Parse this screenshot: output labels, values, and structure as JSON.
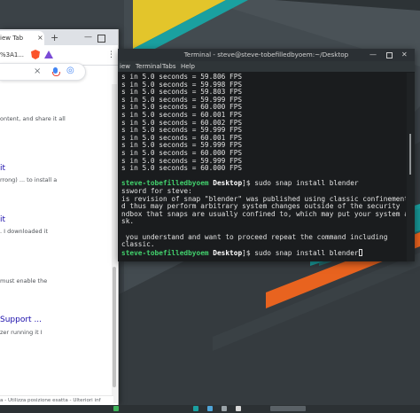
{
  "colors": {
    "accent_green": "#42d16d",
    "stripe_yellow": "#e3c52b",
    "stripe_teal": "#1aa0a0",
    "stripe_orange": "#e8631f",
    "terminal_bg": "#1a1c1e"
  },
  "browser": {
    "tab_title": "iew Tab",
    "tab_close": "×",
    "new_tab": "+",
    "minimize": "—",
    "url_fragment": "%3A1...",
    "menu_icon": "⋮",
    "search_clear": "×",
    "results": [
      {
        "snippet": "ontent, and share it all"
      },
      {
        "link": "it",
        "snippet": "rrong) ... to install a"
      },
      {
        "link": "it",
        "snippet": ". I downloaded it"
      },
      {
        "snippet": "must enable the"
      },
      {
        "link": "Support ...",
        "snippet": "zer running it I"
      }
    ],
    "status_text": "a - Utilizza posizione esatta - Ulteriori inf"
  },
  "terminal": {
    "title": "Terminal - steve@steve-tobefilledbyoem:~/Desktop",
    "menu": [
      "iew",
      "Terminal",
      "Tabs",
      "Help"
    ],
    "fps_lines": [
      "s in 5.0 seconds = 59.806 FPS",
      "s in 5.0 seconds = 59.998 FPS",
      "s in 5.0 seconds = 59.803 FPS",
      "s in 5.0 seconds = 59.999 FPS",
      "s in 5.0 seconds = 60.000 FPS",
      "s in 5.0 seconds = 60.001 FPS",
      "s in 5.0 seconds = 60.002 FPS",
      "s in 5.0 seconds = 59.999 FPS",
      "s in 5.0 seconds = 60.001 FPS",
      "s in 5.0 seconds = 59.999 FPS",
      "s in 5.0 seconds = 60.000 FPS",
      "s in 5.0 seconds = 59.999 FPS",
      "s in 5.0 seconds = 60.000 FPS"
    ],
    "prompt_user": "steve-tobefilledbyoem",
    "prompt_dir": "Desktop",
    "prompt_suffix": "]$",
    "command": " sudo snap install blender",
    "output_lines": [
      "ssword for steve:",
      "is revision of snap \"blender\" was published using classic confinement",
      "d thus may perform arbitrary system changes outside of the security",
      "ndbox that snaps are usually confined to, which may put your system at",
      "sk.",
      "",
      " you understand and want to proceed repeat the command including",
      "classic."
    ],
    "command2": " sudo snap install blender"
  },
  "taskbar": {
    "icons": [
      "files-icon",
      "terminal-icon",
      "browser-icon",
      "settings-icon",
      "app-icon"
    ]
  }
}
